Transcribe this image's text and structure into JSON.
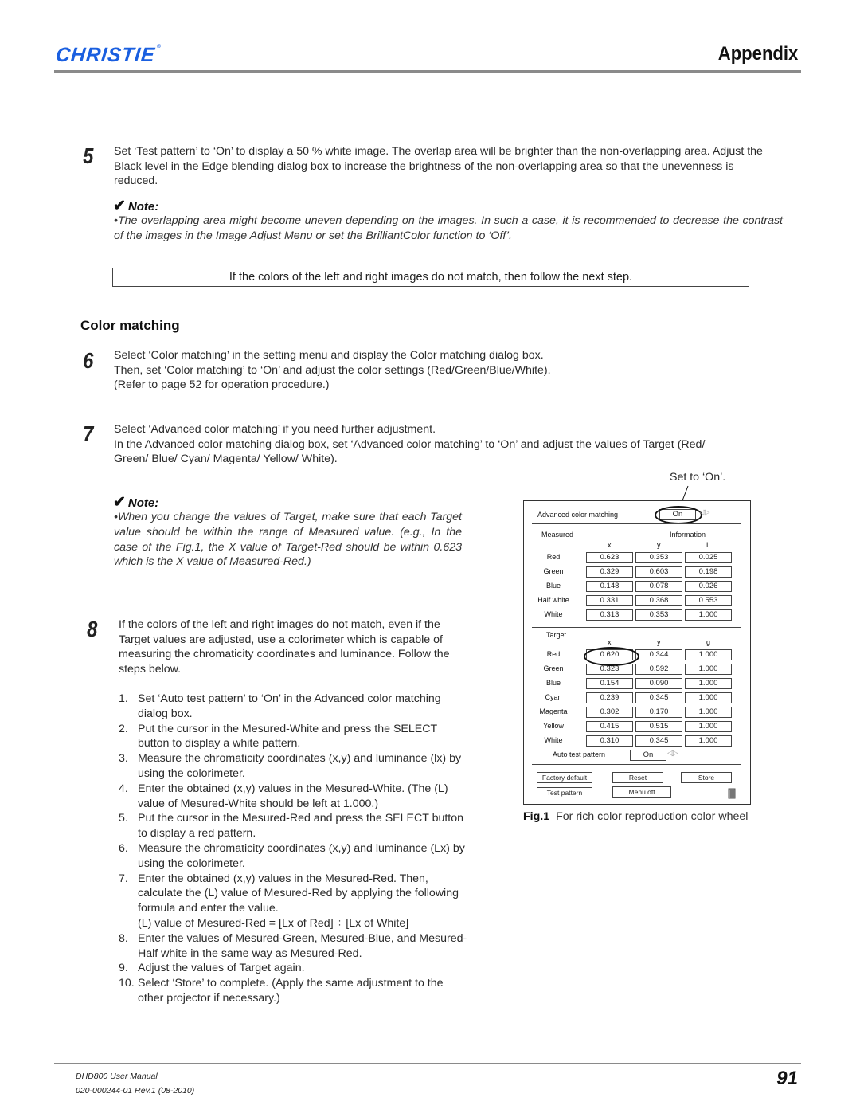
{
  "header": {
    "brand": "CHRISTIE",
    "brand_mark": "®",
    "section_title": "Appendix",
    "brand_color": "#1a5fe0"
  },
  "step5": {
    "number": "5",
    "text": "Set ‘Test pattern’ to ‘On’ to display a 50 % white image. The overlap area will be brighter than the non-overlapping area. Adjust the Black level in the Edge blending dialog box to increase the brightness of the non-overlapping area so that the unevenness is reduced.",
    "note_label": "Note:",
    "note_text": "•The overlapping area might become uneven depending on the images. In such a case, it is recommended to decrease the contrast of the images in the Image Adjust Menu or set the BrilliantColor function to ‘Off’."
  },
  "callout": "If the colors of the left and right images do not match, then follow the next step.",
  "color_matching": {
    "heading": "Color matching",
    "step6": {
      "number": "6",
      "lines": [
        "Select ‘Color matching’ in the setting menu and display the Color matching dialog box.",
        "Then, set ‘Color matching’ to ‘On’ and adjust the color settings (Red/Green/Blue/White).",
        "(Refer to page 52 for operation procedure.)"
      ]
    },
    "step7": {
      "number": "7",
      "lines": [
        "Select ‘Advanced color matching’ if you need further adjustment.",
        "In the Advanced color matching dialog box, set ‘Advanced color matching’ to ‘On’ and adjust the values of Target (Red/",
        "Green/ Blue/ Cyan/ Magenta/ Yellow/ White)."
      ],
      "note_label": "Note:",
      "note_text": "•When you change the values of Target, make sure that each Target value should be within the range of Measured value. (e.g., In the case of the Fig.1, the X value of Target-Red should be within 0.623 which is the X value of Measured-Red.)"
    },
    "step8": {
      "number": "8",
      "intro": "If the colors of the left and right images do not match, even if the Target values are adjusted, use a colorimeter which is capable of measuring the chromaticity coordinates and luminance. Follow the steps below.",
      "items": [
        {
          "n": "1.",
          "text": "Set ‘Auto test pattern’ to ‘On’ in the Advanced color matching dialog box."
        },
        {
          "n": "2.",
          "text": "Put the cursor in the Mesured-White and press the SELECT button to display a white pattern."
        },
        {
          "n": "3.",
          "text": "Measure the chromaticity coordinates (x,y) and luminance (lx) by using the colorimeter."
        },
        {
          "n": "4.",
          "text": "Enter the obtained (x,y) values in the Mesured-White. (The (L) value of Mesured-White should be left at 1.000.)"
        },
        {
          "n": "5.",
          "text": "Put the cursor in the Mesured-Red and press the SELECT button to display a red pattern."
        },
        {
          "n": "6.",
          "text": "Measure the chromaticity coordinates (x,y) and luminance (Lx) by using the colorimeter."
        },
        {
          "n": "7.",
          "text": "Enter the obtained (x,y) values in the Mesured-Red. Then, calculate the (L) value of Mesured-Red by applying the following formula and enter the value."
        },
        {
          "n": "",
          "text": "(L) value of Mesured-Red = [Lx of Red] ÷ [Lx of White]"
        },
        {
          "n": "8.",
          "text": "Enter the values of Mesured-Green, Mesured-Blue, and Mesured-Half white in the same way as Mesured-Red."
        },
        {
          "n": "9.",
          "text": "Adjust the values of Target again."
        },
        {
          "n": "10.",
          "text": "Select ‘Store’ to complete. (Apply the same adjustment to the other projector if necessary.)"
        }
      ]
    }
  },
  "figure": {
    "annotation": "Set to ‘On’.",
    "title": "Advanced color matching",
    "title_value": "On",
    "measured": {
      "label": "Measured",
      "info_label": "Information",
      "columns": [
        "x",
        "y",
        "L"
      ],
      "rows": [
        {
          "name": "Red",
          "values": [
            "0.623",
            "0.353",
            "0.025"
          ]
        },
        {
          "name": "Green",
          "values": [
            "0.329",
            "0.603",
            "0.198"
          ]
        },
        {
          "name": "Blue",
          "values": [
            "0.148",
            "0.078",
            "0.026"
          ]
        },
        {
          "name": "Half white",
          "values": [
            "0.331",
            "0.368",
            "0.553"
          ]
        },
        {
          "name": "White",
          "values": [
            "0.313",
            "0.353",
            "1.000"
          ]
        }
      ]
    },
    "target": {
      "label": "Target",
      "columns": [
        "x",
        "y",
        "g"
      ],
      "rows": [
        {
          "name": "Red",
          "values": [
            "0.620",
            "0.344",
            "1.000"
          ]
        },
        {
          "name": "Green",
          "values": [
            "0.323",
            "0.592",
            "1.000"
          ]
        },
        {
          "name": "Blue",
          "values": [
            "0.154",
            "0.090",
            "1.000"
          ]
        },
        {
          "name": "Cyan",
          "values": [
            "0.239",
            "0.345",
            "1.000"
          ]
        },
        {
          "name": "Magenta",
          "values": [
            "0.302",
            "0.170",
            "1.000"
          ]
        },
        {
          "name": "Yellow",
          "values": [
            "0.415",
            "0.515",
            "1.000"
          ]
        },
        {
          "name": "White",
          "values": [
            "0.310",
            "0.345",
            "1.000"
          ]
        }
      ]
    },
    "auto_test_pattern_label": "Auto test pattern",
    "auto_test_pattern_value": "On",
    "buttons": {
      "factory_default": "Factory default",
      "reset": "Reset",
      "store": "Store",
      "test_pattern": "Test pattern",
      "menu_off": "Menu off"
    },
    "caption_label": "Fig.1",
    "caption_text": "For rich color reproduction color wheel"
  },
  "footer": {
    "manual": "DHD800 User Manual",
    "doc_id": "020-000244-01 Rev.1 (08-2010)",
    "page_number": "91"
  }
}
